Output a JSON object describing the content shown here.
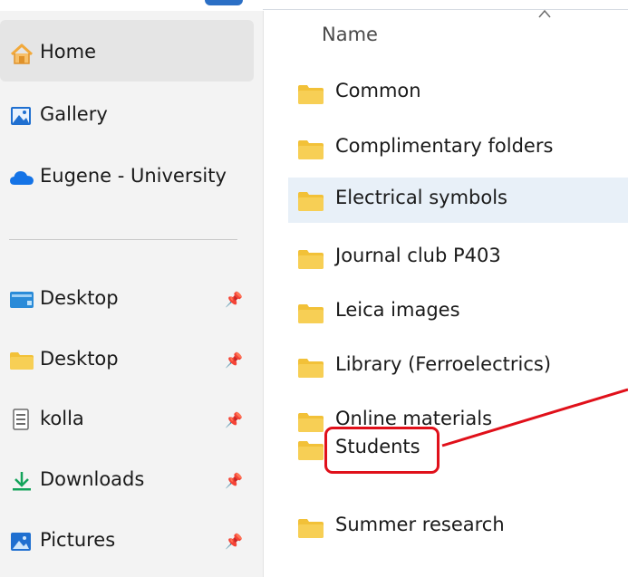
{
  "navigation": {
    "items": [
      {
        "label": "Home",
        "icon": "home-icon",
        "pinned": false,
        "selected": true
      },
      {
        "label": "Gallery",
        "icon": "gallery-icon",
        "pinned": false,
        "selected": false
      },
      {
        "label": "Eugene - University",
        "icon": "onedrive-cloud-icon",
        "pinned": false,
        "selected": false
      },
      {
        "label": "Desktop",
        "icon": "desktop-blue-folder-icon",
        "pinned": true,
        "selected": false
      },
      {
        "label": "Desktop",
        "icon": "folder-icon",
        "pinned": true,
        "selected": false
      },
      {
        "label": "kolla",
        "icon": "text-document-icon",
        "pinned": true,
        "selected": false
      },
      {
        "label": "Downloads",
        "icon": "download-arrow-icon",
        "pinned": true,
        "selected": false
      },
      {
        "label": "Pictures",
        "icon": "pictures-icon",
        "pinned": true,
        "selected": false
      }
    ]
  },
  "content": {
    "column_header": "Name",
    "sort_indicator": "caret-up-icon",
    "files": [
      {
        "name": "Common",
        "selected": false
      },
      {
        "name": "Complimentary folders",
        "selected": false
      },
      {
        "name": "Electrical symbols",
        "selected": true
      },
      {
        "name": "Journal club P403",
        "selected": false
      },
      {
        "name": "Leica images",
        "selected": false
      },
      {
        "name": "Library (Ferroelectrics)",
        "selected": false
      },
      {
        "name": "Online materials",
        "selected": false
      },
      {
        "name": "Students",
        "selected": false,
        "highlighted": true
      },
      {
        "name": "Summer research",
        "selected": false
      }
    ]
  },
  "colors": {
    "annotation": "#e0101a",
    "folder": "#f2c138",
    "selection": "#e8f0f8",
    "accent": "#2b6fc5"
  }
}
